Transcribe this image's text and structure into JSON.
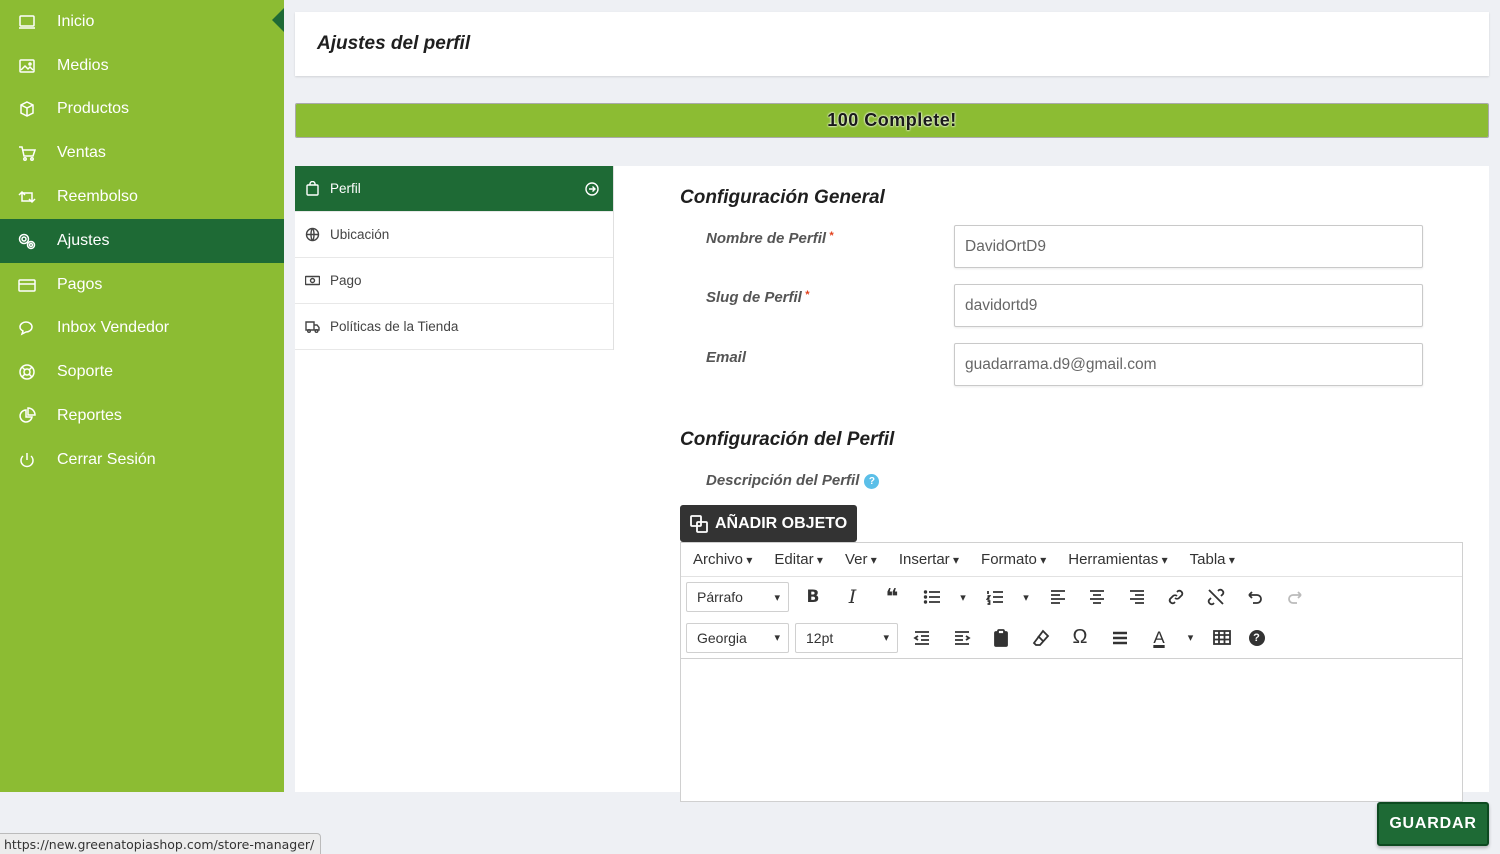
{
  "sidebar": {
    "items": [
      {
        "label": "Inicio",
        "icon": "monitor-icon"
      },
      {
        "label": "Medios",
        "icon": "image-icon"
      },
      {
        "label": "Productos",
        "icon": "cube-icon"
      },
      {
        "label": "Ventas",
        "icon": "cart-icon"
      },
      {
        "label": "Reembolso",
        "icon": "retweet-icon"
      },
      {
        "label": "Ajustes",
        "icon": "gears-icon"
      },
      {
        "label": "Pagos",
        "icon": "credit-card-icon"
      },
      {
        "label": "Inbox Vendedor",
        "icon": "chat-icon"
      },
      {
        "label": "Soporte",
        "icon": "lifebuoy-icon"
      },
      {
        "label": "Reportes",
        "icon": "pie-chart-icon"
      },
      {
        "label": "Cerrar Sesión",
        "icon": "power-icon"
      }
    ],
    "active": "Ajustes"
  },
  "header": {
    "title": "Ajustes del perfil"
  },
  "progress": {
    "label": "100 Complete!",
    "percent": 100
  },
  "tabs": [
    {
      "label": "Perfil",
      "icon": "shopping-bag-icon"
    },
    {
      "label": "Ubicación",
      "icon": "globe-icon"
    },
    {
      "label": "Pago",
      "icon": "money-icon"
    },
    {
      "label": "Políticas de la Tienda",
      "icon": "truck-icon"
    }
  ],
  "general": {
    "title": "Configuración General",
    "fields": [
      {
        "label": "Nombre de Perfil",
        "required": "*",
        "value": "DavidOrtD9"
      },
      {
        "label": "Slug de Perfil",
        "required": "*",
        "value": "davidortd9"
      },
      {
        "label": "Email",
        "value": "guadarrama.d9@gmail.com"
      }
    ]
  },
  "profile": {
    "title": "Configuración del Perfil",
    "description_label": "Descripción del Perfil",
    "help_glyph": "?"
  },
  "editor": {
    "add_object": "AÑADIR OBJETO",
    "menus": [
      "Archivo",
      "Editar",
      "Ver",
      "Insertar",
      "Formato",
      "Herramientas",
      "Tabla"
    ],
    "block_format": "Párrafo",
    "font_family": "Georgia",
    "font_size": "12pt",
    "glyphs": {
      "bold": "B",
      "italic": "I",
      "quote": "❝",
      "omega": "Ω",
      "textcolor": "A",
      "help": "?",
      "dropdown": "▾"
    }
  },
  "footer": {
    "url": "https://new.greenatopiashop.com/store-manager/",
    "save_label": "GUARDAR"
  },
  "colors": {
    "sidebar": "#8cbc33",
    "active": "#1e6a35",
    "background": "#eef0f4"
  }
}
